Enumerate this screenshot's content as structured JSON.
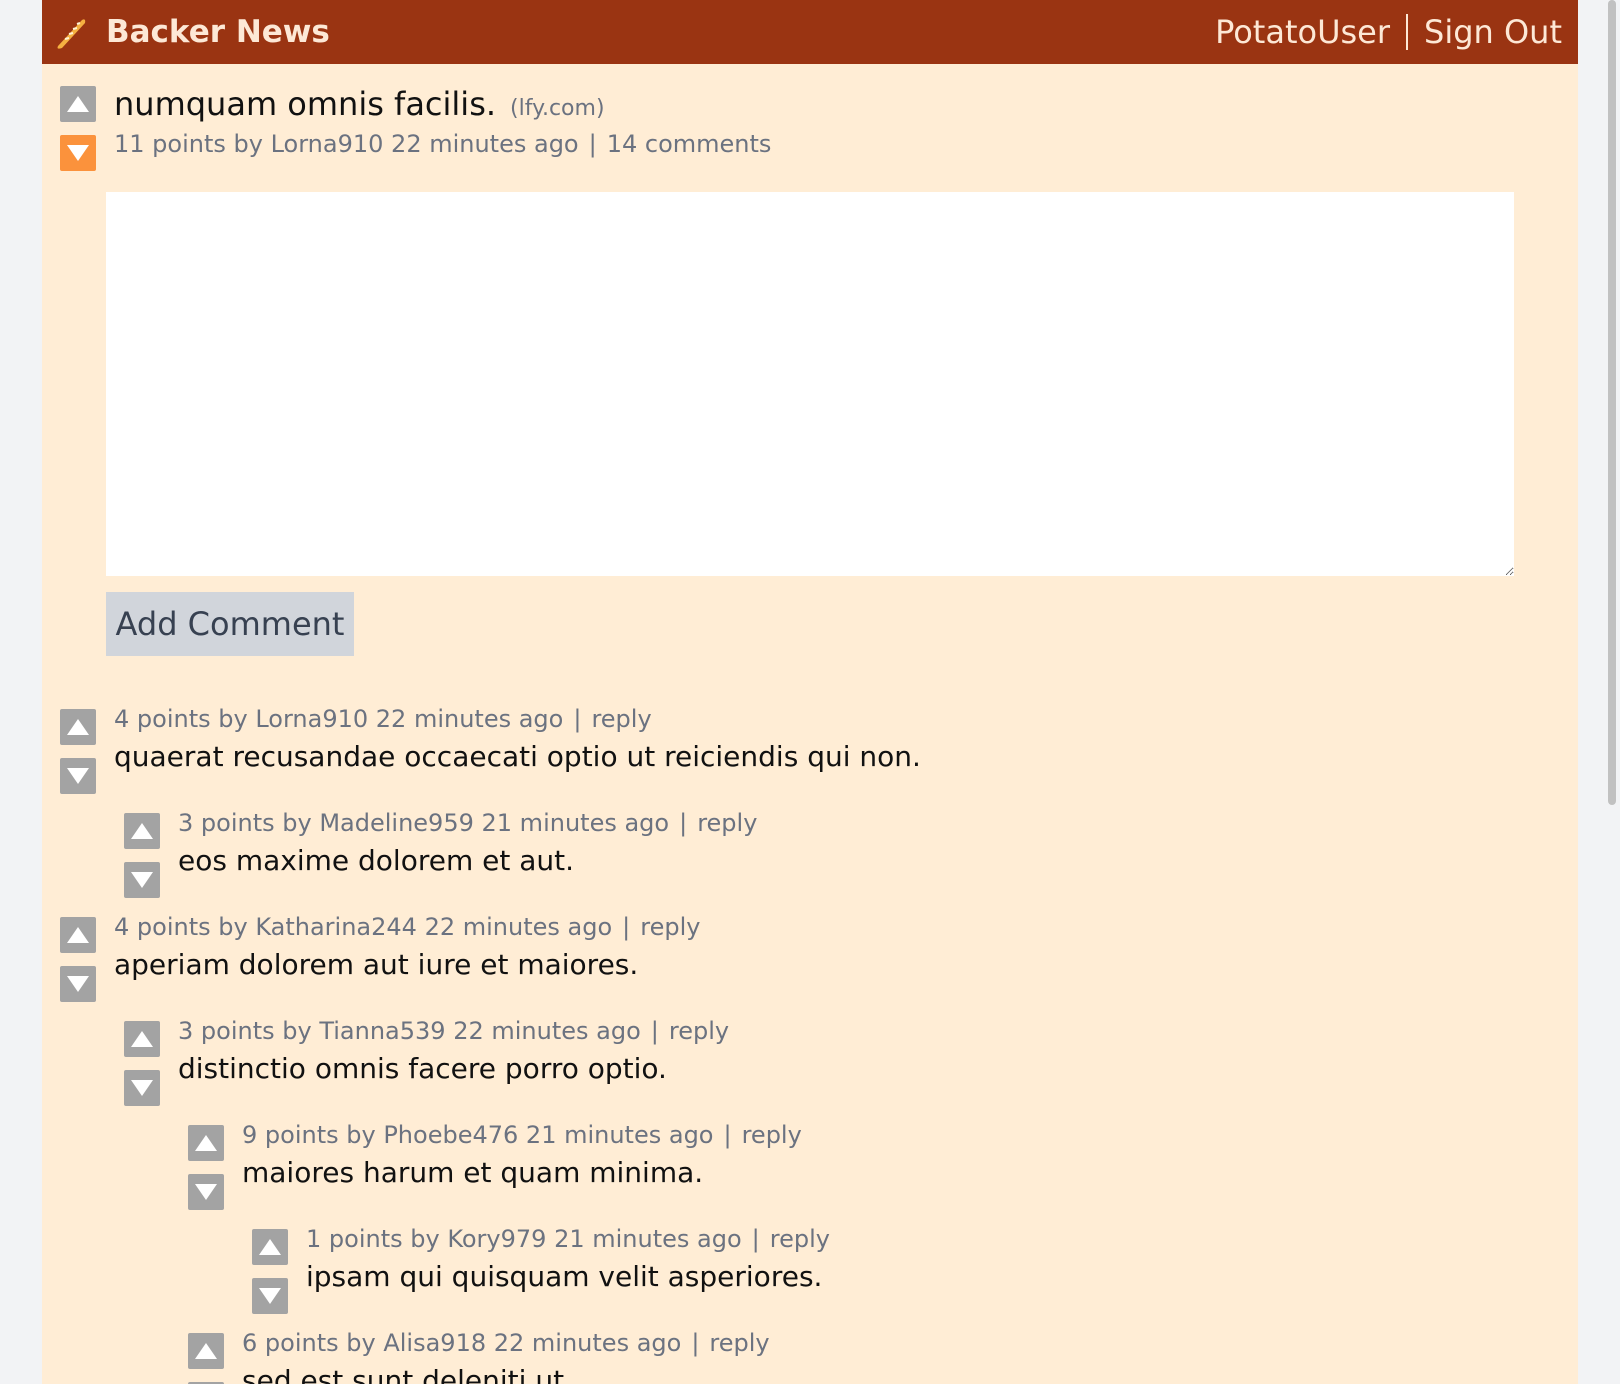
{
  "header": {
    "brand": "Backer News",
    "logo_icon": "baguette-icon",
    "user": "PotatoUser",
    "sign_out": "Sign Out",
    "bg_color": "#9a3412"
  },
  "story": {
    "title": "numquam omnis facilis.",
    "domain": "(lfy.com)",
    "points_by": "11 points by",
    "author": "Lorna910",
    "age": "22 minutes ago",
    "comments_link": "14 comments",
    "upvoted": false,
    "downvoted": true
  },
  "comment_form": {
    "value": "",
    "button_label": "Add Comment"
  },
  "separator": "|",
  "comments": [
    {
      "points_by": "4 points by",
      "author": "Lorna910",
      "age": "22 minutes ago",
      "reply": "reply",
      "text": "quaerat recusandae occaecati optio ut reiciendis qui non.",
      "depth": 0
    },
    {
      "points_by": "3 points by",
      "author": "Madeline959",
      "age": "21 minutes ago",
      "reply": "reply",
      "text": "eos maxime dolorem et aut.",
      "depth": 1
    },
    {
      "points_by": "4 points by",
      "author": "Katharina244",
      "age": "22 minutes ago",
      "reply": "reply",
      "text": "aperiam dolorem aut iure et maiores.",
      "depth": 0
    },
    {
      "points_by": "3 points by",
      "author": "Tianna539",
      "age": "22 minutes ago",
      "reply": "reply",
      "text": "distinctio omnis facere porro optio.",
      "depth": 1
    },
    {
      "points_by": "9 points by",
      "author": "Phoebe476",
      "age": "21 minutes ago",
      "reply": "reply",
      "text": "maiores harum et quam minima.",
      "depth": 2
    },
    {
      "points_by": "1 points by",
      "author": "Kory979",
      "age": "21 minutes ago",
      "reply": "reply",
      "text": "ipsam qui quisquam velit asperiores.",
      "depth": 3
    },
    {
      "points_by": "6 points by",
      "author": "Alisa918",
      "age": "22 minutes ago",
      "reply": "reply",
      "text": "sed est sunt deleniti ut.",
      "depth": 2
    }
  ]
}
